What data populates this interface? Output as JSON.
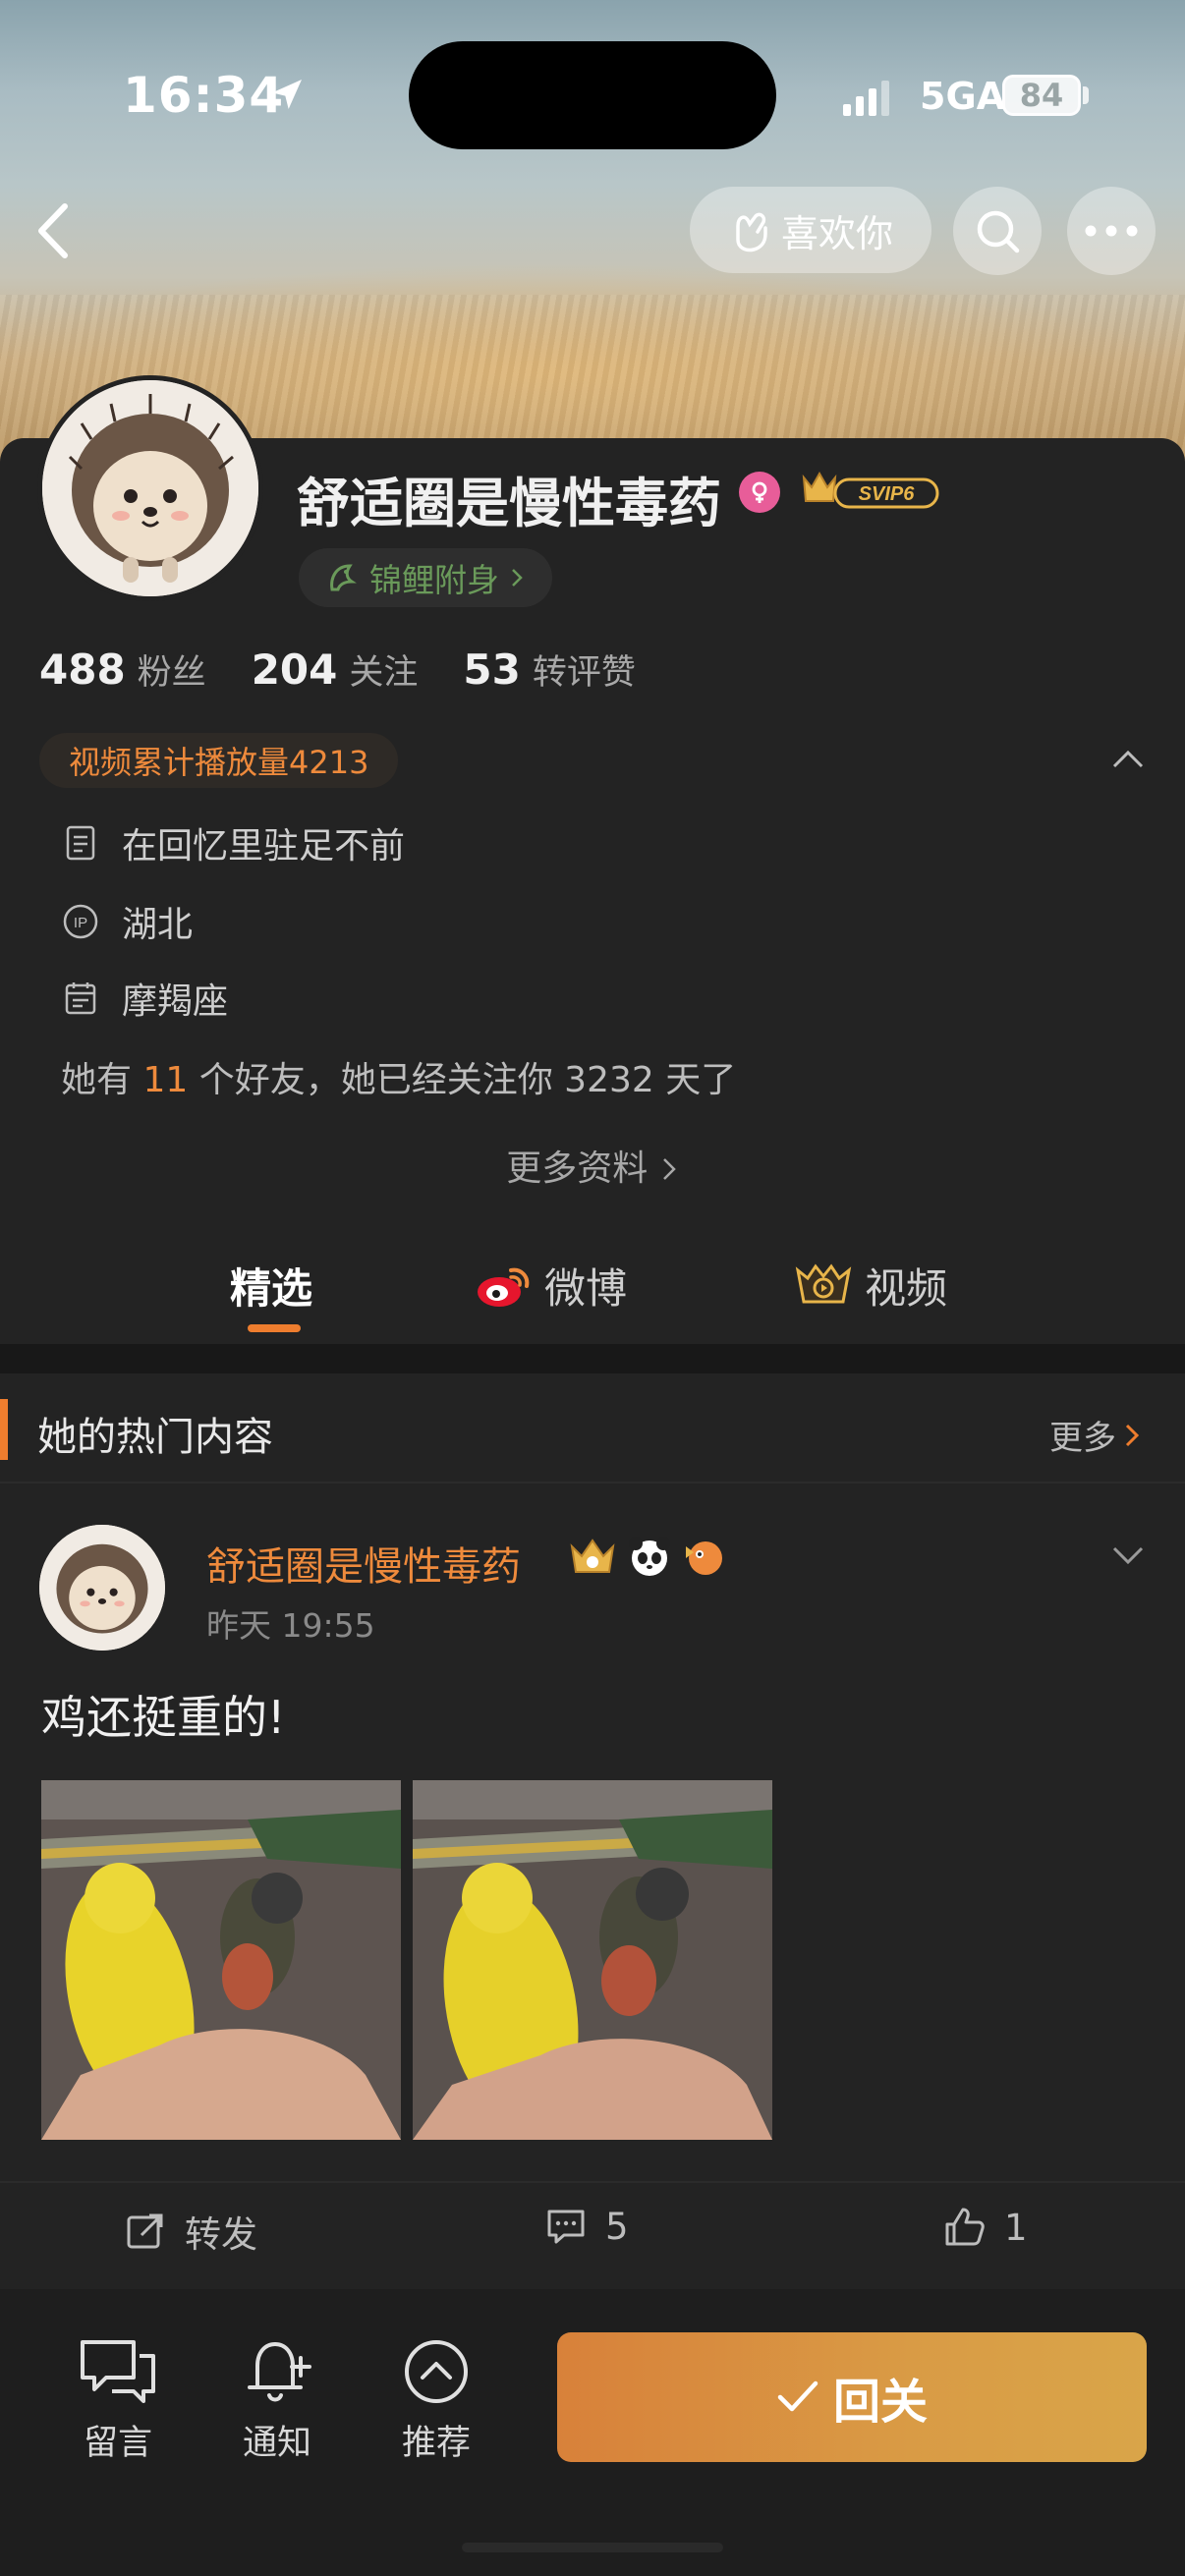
{
  "status_bar": {
    "time": "16:34",
    "network": "5GA",
    "battery": "84"
  },
  "header": {
    "like_label": "喜欢你"
  },
  "profile": {
    "name": "舒适圈是慢性毒药",
    "membership": "SVIP6",
    "fortune_label": "锦鲤附身",
    "stats": [
      {
        "num": "488",
        "unit": "粉丝"
      },
      {
        "num": "204",
        "unit": "关注"
      },
      {
        "num": "53",
        "unit": "转评赞"
      }
    ],
    "video_plays": "视频累计播放量4213",
    "bio": "在回忆里驻足不前",
    "ip_location": "湖北",
    "zodiac": "摩羯座",
    "friends_prefix": "她有",
    "friends_count": "11",
    "friends_suffix": "个好友，她已经关注你 3232 天了",
    "more_info": "更多资料"
  },
  "tabs": [
    {
      "label": "精选",
      "active": true
    },
    {
      "label": "微博",
      "active": false
    },
    {
      "label": "视频",
      "active": false
    }
  ],
  "hot_section": {
    "title": "她的热门内容",
    "more": "更多",
    "post": {
      "author": "舒适圈是慢性毒药",
      "time": "昨天 19:55",
      "text": "鸡还挺重的!",
      "repost_label": "转发",
      "comment_count": "5",
      "like_count": "1"
    }
  },
  "bottom_bar": {
    "message": "留言",
    "notify": "通知",
    "recommend": "推荐",
    "follow_back": "回关"
  },
  "colors": {
    "accent": "#ee7d2e",
    "background": "#232323",
    "follow_button": "#d9933f",
    "female_badge": "#e85d99"
  }
}
